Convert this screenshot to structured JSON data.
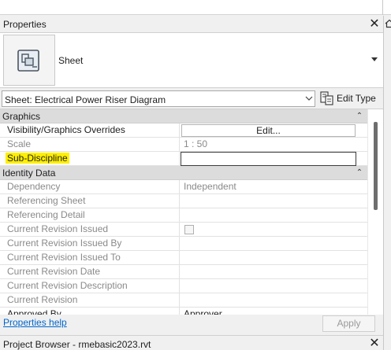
{
  "panel": {
    "title": "Properties",
    "close_glyph": "✕"
  },
  "type_selector": {
    "name": "Sheet",
    "icon": "sheet-icon"
  },
  "instance_selector": {
    "value": "Sheet: Electrical Power Riser Diagram",
    "edit_type_label": "Edit Type"
  },
  "groups": [
    {
      "name": "Graphics",
      "collapse_glyph": "⌃",
      "rows": [
        {
          "name": "Visibility/Graphics Overrides",
          "value": "Edit...",
          "kind": "button",
          "dim": false
        },
        {
          "name": "Scale",
          "value": "1 : 50",
          "kind": "text",
          "dim": true
        },
        {
          "name": "Sub-Discipline",
          "value": "",
          "kind": "editing",
          "dim": false,
          "highlighted": true,
          "highlight_color": "#ffef00"
        }
      ]
    },
    {
      "name": "Identity Data",
      "collapse_glyph": "⌃",
      "rows": [
        {
          "name": "Dependency",
          "value": "Independent",
          "kind": "text",
          "dim": true
        },
        {
          "name": "Referencing Sheet",
          "value": "",
          "kind": "text",
          "dim": true
        },
        {
          "name": "Referencing Detail",
          "value": "",
          "kind": "text",
          "dim": true
        },
        {
          "name": "Current Revision Issued",
          "value": "",
          "kind": "checkbox",
          "dim": true
        },
        {
          "name": "Current Revision Issued By",
          "value": "",
          "kind": "text",
          "dim": true
        },
        {
          "name": "Current Revision Issued To",
          "value": "",
          "kind": "text",
          "dim": true
        },
        {
          "name": "Current Revision Date",
          "value": "",
          "kind": "text",
          "dim": true
        },
        {
          "name": "Current Revision Description",
          "value": "",
          "kind": "text",
          "dim": true
        },
        {
          "name": "Current Revision",
          "value": "",
          "kind": "text",
          "dim": true
        },
        {
          "name": "Approved By",
          "value": "Approver",
          "kind": "text",
          "dim": false
        }
      ]
    }
  ],
  "footer": {
    "help_link": "Properties help",
    "apply_label": "Apply"
  },
  "project_browser": {
    "title": "Project Browser - rmebasic2023.rvt"
  }
}
